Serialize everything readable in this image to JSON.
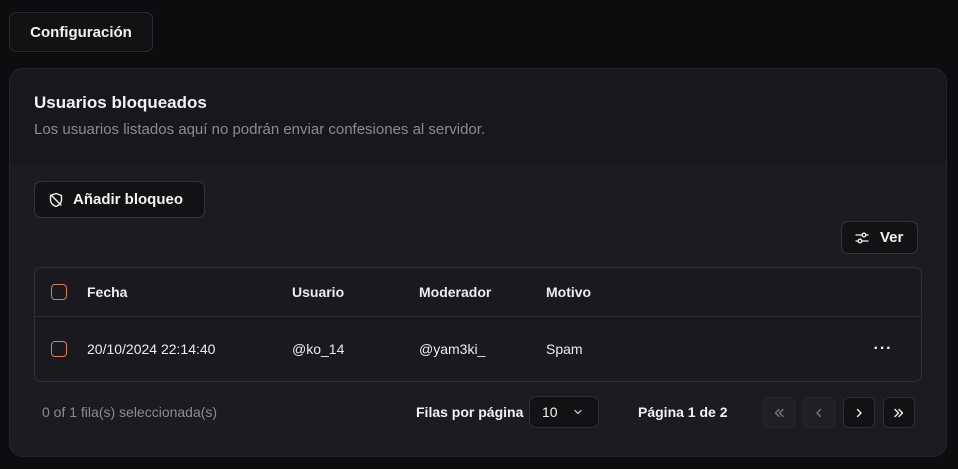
{
  "tab": {
    "label": "Configuración"
  },
  "card": {
    "title": "Usuarios bloqueados",
    "description": "Los usuarios listados aquí no podrán enviar confesiones al servidor."
  },
  "toolbar": {
    "add_label": "Añadir bloqueo",
    "add_icon": "shield-off-icon",
    "view_label": "Ver",
    "view_icon": "sliders-icon"
  },
  "table": {
    "columns": [
      "Fecha",
      "Usuario",
      "Moderador",
      "Motivo"
    ],
    "rows": [
      {
        "fecha": "20/10/2024 22:14:40",
        "usuario": "@ko_14",
        "moderador": "@yam3ki_",
        "motivo": "Spam",
        "actions": "···"
      }
    ],
    "checkbox_color": "#e07a5f"
  },
  "footer": {
    "selection": "0 of 1 fila(s) seleccionada(s)",
    "rows_per_page_label": "Filas por página",
    "rows_per_page_value": "10",
    "page_label": "Página 1 de 2"
  }
}
